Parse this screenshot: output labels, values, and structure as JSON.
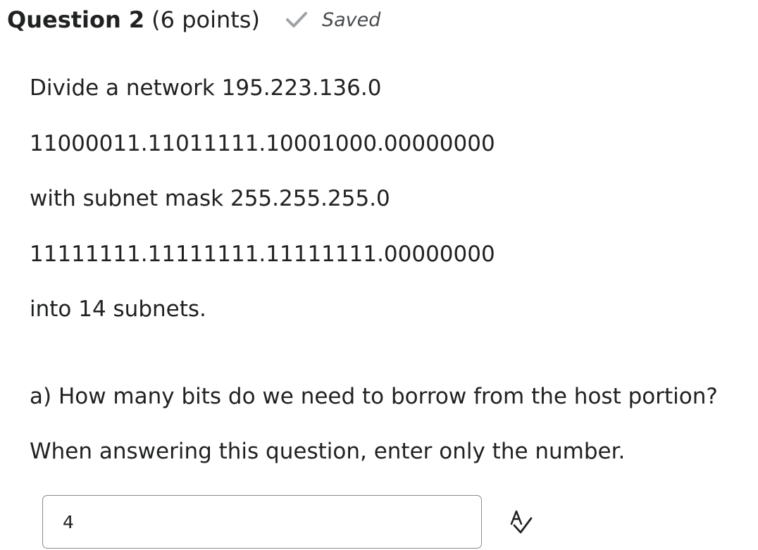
{
  "question": {
    "title": "Question 2",
    "points": "(6 points)",
    "status": "Saved"
  },
  "body": {
    "line1": "Divide a network 195.223.136.0",
    "line2": "11000011.11011111.10001000.00000000",
    "line3": "with subnet mask 255.255.255.0",
    "line4": "11111111.11111111.11111111.00000000",
    "line5": "into 14 subnets.",
    "line6": "a) How many bits do we need to borrow from the host portion?",
    "line7": "When answering this question, enter only the number."
  },
  "answer": {
    "value": "4"
  },
  "icons": {
    "status": "checkmark-icon",
    "spellcheck": "spellcheck-icon"
  },
  "colors": {
    "text": "#202122",
    "muted": "#494c4e",
    "check": "#9ea3a7",
    "border": "#868c90"
  }
}
